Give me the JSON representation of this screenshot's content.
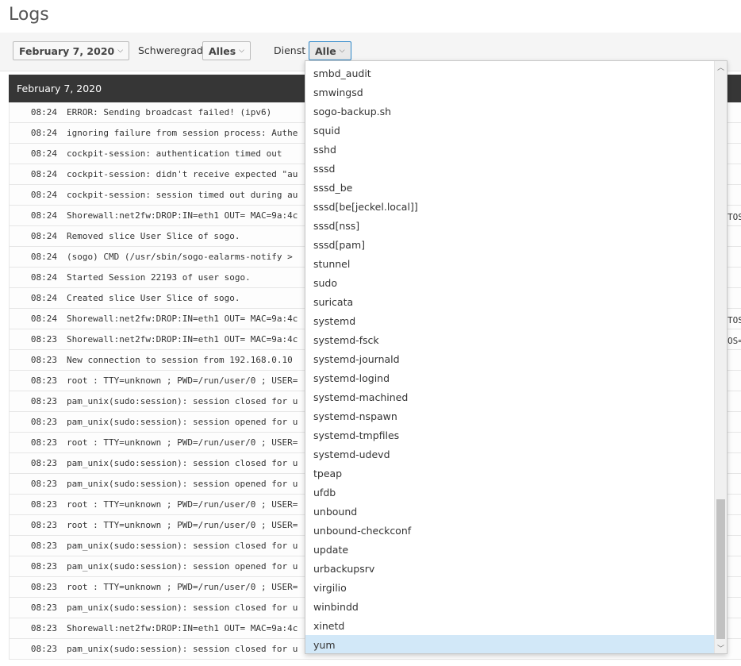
{
  "page": {
    "title": "Logs"
  },
  "toolbar": {
    "date_button": "February 7, 2020",
    "severity_label": "Schweregrad",
    "severity_button": "Alles",
    "service_label": "Dienst",
    "service_button": "Alle",
    "caret": "⌵"
  },
  "log_group": {
    "date": "February 7, 2020",
    "entries": [
      {
        "time": "08:24",
        "message": "ERROR: Sending broadcast failed! (ipv6)"
      },
      {
        "time": "08:24",
        "message": "ignoring failure from session process: Authe"
      },
      {
        "time": "08:24",
        "message": "cockpit-session: authentication timed out"
      },
      {
        "time": "08:24",
        "message": "cockpit-session: didn't receive expected \"au"
      },
      {
        "time": "08:24",
        "message": "cockpit-session: session timed out during au"
      },
      {
        "time": "08:24",
        "message": "Shorewall:net2fw:DROP:IN=eth1 OUT= MAC=9a:4c"
      },
      {
        "time": "08:24",
        "message": "Removed slice User Slice of sogo."
      },
      {
        "time": "08:24",
        "message": "(sogo) CMD (/usr/sbin/sogo-ealarms-notify >"
      },
      {
        "time": "08:24",
        "message": "Started Session 22193 of user sogo."
      },
      {
        "time": "08:24",
        "message": "Created slice User Slice of sogo."
      },
      {
        "time": "08:24",
        "message": "Shorewall:net2fw:DROP:IN=eth1 OUT= MAC=9a:4c"
      },
      {
        "time": "08:23",
        "message": "Shorewall:net2fw:DROP:IN=eth1 OUT= MAC=9a:4c"
      },
      {
        "time": "08:23",
        "message": "New connection to session from 192.168.0.10"
      },
      {
        "time": "08:23",
        "message": "root : TTY=unknown ; PWD=/run/user/0 ; USER="
      },
      {
        "time": "08:23",
        "message": "pam_unix(sudo:session): session closed for u"
      },
      {
        "time": "08:23",
        "message": "pam_unix(sudo:session): session opened for u"
      },
      {
        "time": "08:23",
        "message": "root : TTY=unknown ; PWD=/run/user/0 ; USER="
      },
      {
        "time": "08:23",
        "message": "pam_unix(sudo:session): session closed for u"
      },
      {
        "time": "08:23",
        "message": "pam_unix(sudo:session): session opened for u"
      },
      {
        "time": "08:23",
        "message": "root : TTY=unknown ; PWD=/run/user/0 ; USER="
      },
      {
        "time": "08:23",
        "message": "root : TTY=unknown ; PWD=/run/user/0 ; USER="
      },
      {
        "time": "08:23",
        "message": "pam_unix(sudo:session): session closed for u"
      },
      {
        "time": "08:23",
        "message": "pam_unix(sudo:session): session opened for u"
      },
      {
        "time": "08:23",
        "message": "root : TTY=unknown ; PWD=/run/user/0 ; USER="
      },
      {
        "time": "08:23",
        "message": "pam_unix(sudo:session): session closed for u"
      },
      {
        "time": "08:23",
        "message": "Shorewall:net2fw:DROP:IN=eth1 OUT= MAC=9a:4c"
      },
      {
        "time": "08:23",
        "message": "pam_unix(sudo:session): session closed for u"
      }
    ]
  },
  "right_edge_fragments": [
    "TOS",
    "TOS",
    "OS="
  ],
  "service_dropdown": {
    "items": [
      "smbd_audit",
      "smwingsd",
      "sogo-backup.sh",
      "squid",
      "sshd",
      "sssd",
      "sssd_be",
      "sssd[be[jeckel.local]]",
      "sssd[nss]",
      "sssd[pam]",
      "stunnel",
      "sudo",
      "suricata",
      "systemd",
      "systemd-fsck",
      "systemd-journald",
      "systemd-logind",
      "systemd-machined",
      "systemd-nspawn",
      "systemd-tmpfiles",
      "systemd-udevd",
      "tpeap",
      "ufdb",
      "unbound",
      "unbound-checkconf",
      "update",
      "urbackupsrv",
      "virgilio",
      "winbindd",
      "xinetd",
      "yum"
    ],
    "selected": "yum",
    "scroll_position": 0.75
  }
}
